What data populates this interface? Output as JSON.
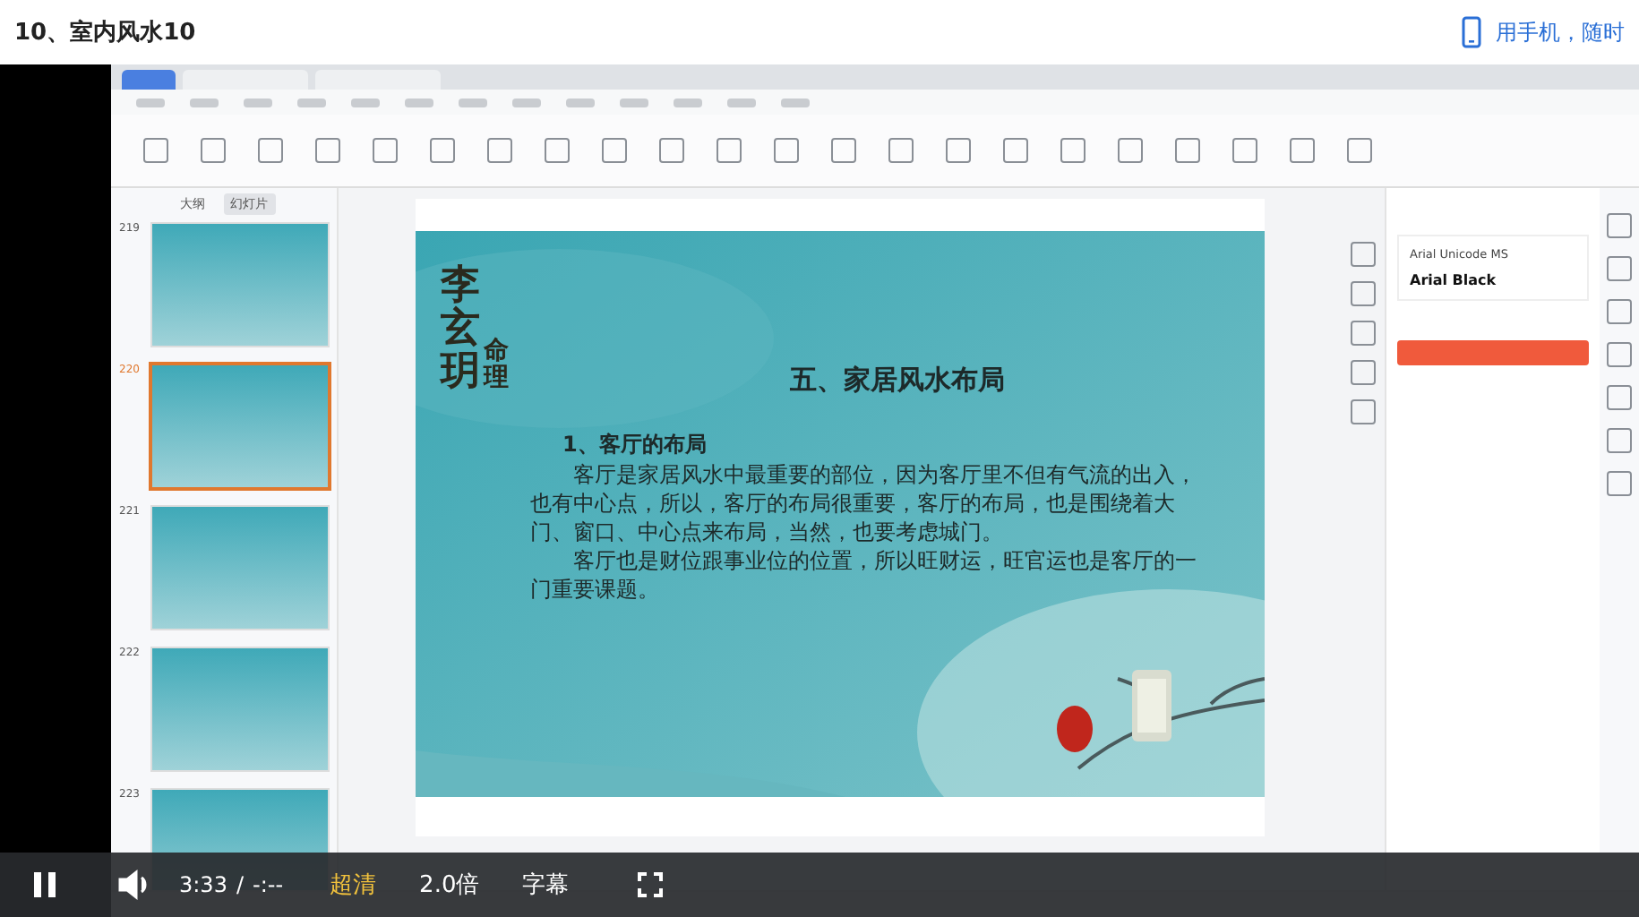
{
  "header": {
    "title": "10、室内风水10",
    "mobile_prompt": "用手机，随时"
  },
  "wps": {
    "panel_tabs": [
      {
        "label": "大纲",
        "selected": false
      },
      {
        "label": "幻灯片",
        "selected": true
      }
    ],
    "thumbnails": [
      {
        "number": "219",
        "selected": false
      },
      {
        "number": "220",
        "selected": true
      },
      {
        "number": "221",
        "selected": false
      },
      {
        "number": "222",
        "selected": false
      },
      {
        "number": "223",
        "selected": false
      }
    ],
    "slide": {
      "logo": "李玄玥",
      "logo_sub": "命理",
      "title": "五、家居风水布局",
      "heading": "1、客厅的布局",
      "paragraphs": [
        "客厅是家居风水中最重要的部位，因为客厅里不但有气流的出入，也有中心点，所以，客厅的布局很重要，客厅的布局，也是围绕着大门、窗口、中心点来布局，当然，也要考虑城门。",
        "客厅也是财位跟事业位的位置，所以旺财运，旺官运也是客厅的一门重要课题。"
      ]
    },
    "font_panel": {
      "fonts": [
        "Arial Unicode MS",
        "Arial Black"
      ]
    }
  },
  "player": {
    "playing": true,
    "time": "3:33",
    "separator": "/",
    "duration": "-:--",
    "quality": "超清",
    "speed": "2.0倍",
    "subtitles": "字幕"
  }
}
